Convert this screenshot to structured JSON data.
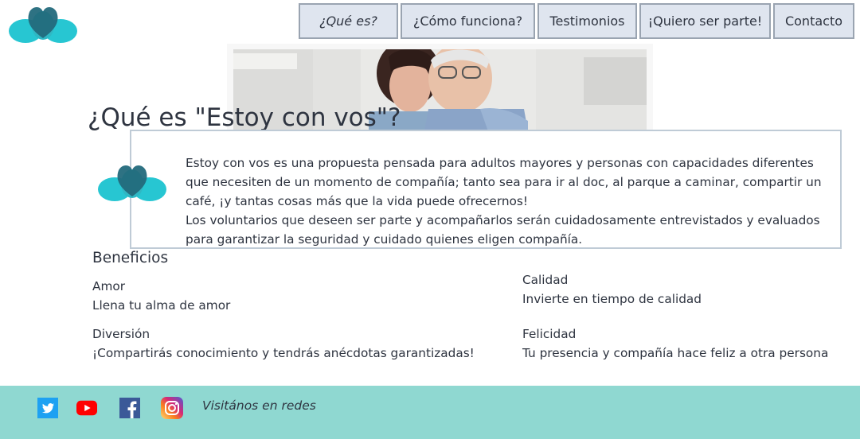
{
  "nav": {
    "items": [
      {
        "label": "¿Qué es?"
      },
      {
        "label": "¿Cómo funciona?"
      },
      {
        "label": "Testimonios"
      },
      {
        "label": "¡Quiero ser parte!"
      },
      {
        "label": "Contacto"
      }
    ],
    "active_index": 0
  },
  "main": {
    "title": "¿Qué es \"Estoy con vos\"?",
    "description": [
      "Estoy con vos es una propuesta pensada para adultos mayores y personas con capacidades diferentes que necesiten de un momento de compañía; tanto sea para ir al doc, al parque a caminar, compartir un café, ¡y tantas cosas más que la vida puede ofrecernos!",
      "Los voluntarios que deseen ser parte y acompañarlos serán cuidadosamente entrevistados y evaluados para garantizar la seguridad y cuidado quienes eligen compañía."
    ]
  },
  "benefits": {
    "title": "Beneficios",
    "items": [
      {
        "name": "Amor",
        "text": "Llena tu alma de amor"
      },
      {
        "name": "Calidad",
        "text": "Invierte en tiempo de calidad"
      },
      {
        "name": "Diversión",
        "text": "¡Compartirás conocimiento y tendrás anécdotas garantizadas!"
      },
      {
        "name": "Felicidad",
        "text": "Tu presencia y compañía hace feliz a otra persona"
      }
    ]
  },
  "footer": {
    "label": "Visitános en redes",
    "social": [
      "twitter-icon",
      "youtube-icon",
      "facebook-icon",
      "instagram-icon"
    ]
  },
  "colors": {
    "logo_light": "#27c6d2",
    "logo_dark": "#236a7c",
    "nav_bg": "#dfe5ef",
    "footer_bg": "#8fd8d1"
  }
}
